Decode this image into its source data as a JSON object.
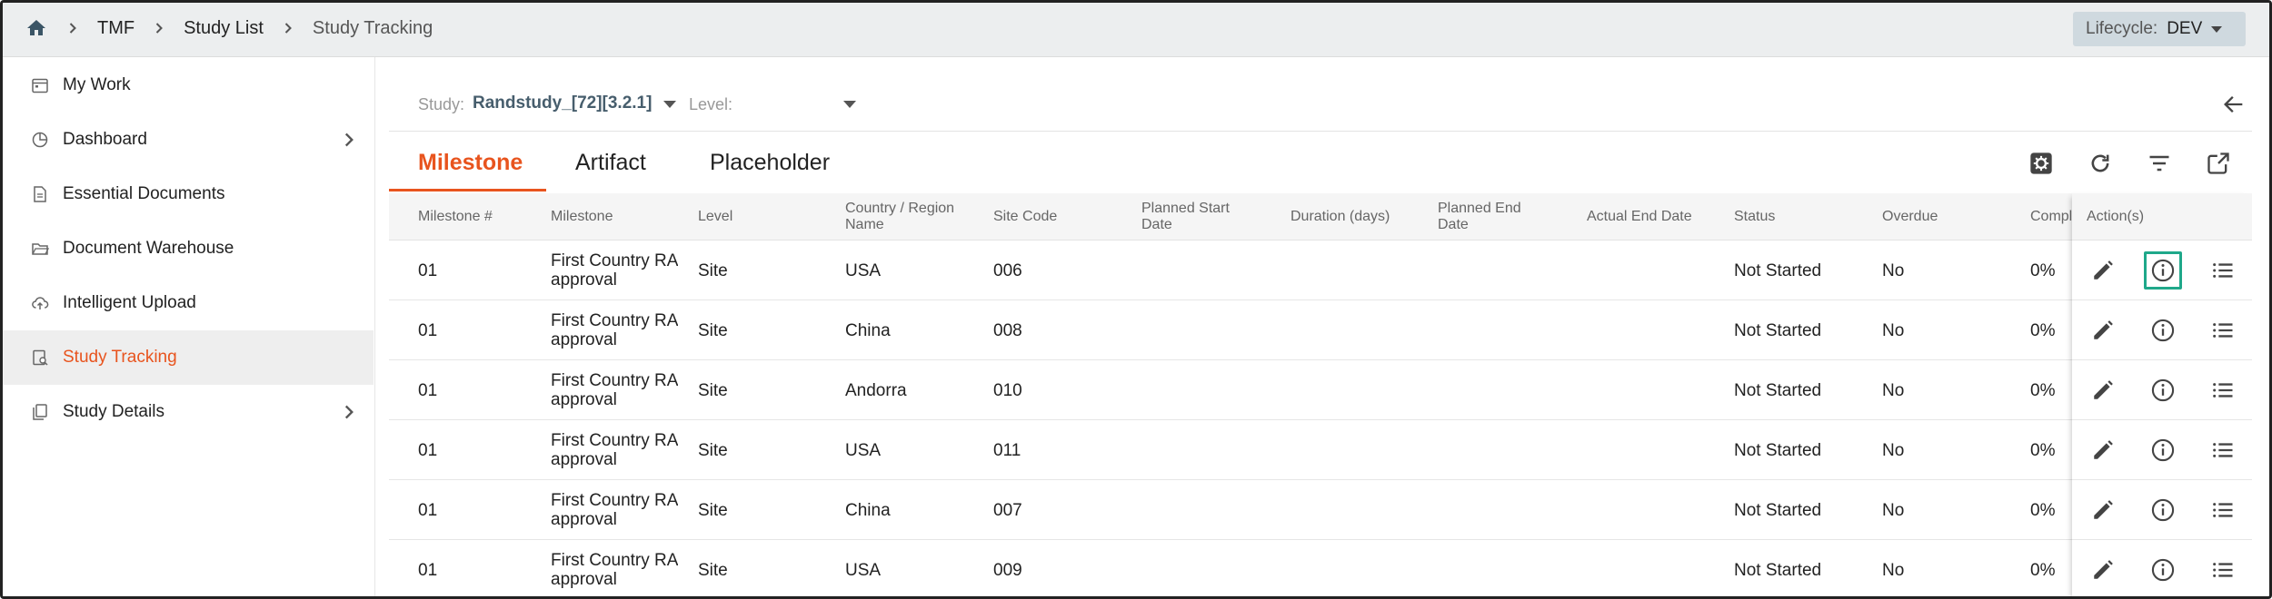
{
  "breadcrumb": {
    "items": [
      "TMF",
      "Study List",
      "Study Tracking"
    ]
  },
  "lifecycle": {
    "label": "Lifecycle:",
    "value": "DEV"
  },
  "sidebar": {
    "items": [
      {
        "label": "My Work",
        "icon": "calendar-icon",
        "has_children": false,
        "active": false
      },
      {
        "label": "Dashboard",
        "icon": "pie-chart-icon",
        "has_children": true,
        "active": false
      },
      {
        "label": "Essential Documents",
        "icon": "document-icon",
        "has_children": false,
        "active": false
      },
      {
        "label": "Document Warehouse",
        "icon": "folder-open-icon",
        "has_children": false,
        "active": false
      },
      {
        "label": "Intelligent Upload",
        "icon": "cloud-upload-icon",
        "has_children": false,
        "active": false
      },
      {
        "label": "Study Tracking",
        "icon": "tracking-icon",
        "has_children": false,
        "active": true
      },
      {
        "label": "Study Details",
        "icon": "copy-document-icon",
        "has_children": true,
        "active": false
      }
    ]
  },
  "filters": {
    "study_label": "Study:",
    "study_value": "Randstudy_[72][3.2.1]",
    "level_label": "Level:",
    "level_value": ""
  },
  "tabs": [
    {
      "label": "Milestone",
      "active": true
    },
    {
      "label": "Artifact",
      "active": false
    },
    {
      "label": "Placeholder",
      "active": false
    }
  ],
  "toolbar_icons": [
    "settings-icon",
    "refresh-icon",
    "filter-icon",
    "open-external-icon"
  ],
  "table": {
    "columns": [
      "Milestone #",
      "Milestone",
      "Level",
      "Country / Region\nName",
      "Site Code",
      "Planned Start\nDate",
      "Duration (days)",
      "Planned End\nDate",
      "Actual End Date",
      "Status",
      "Overdue",
      "Compl"
    ],
    "actions_header": "Action(s)",
    "rows": [
      {
        "milestone_num": "01",
        "milestone": "First Country RA approval",
        "level": "Site",
        "country": "USA",
        "site_code": "006",
        "planned_start": "",
        "duration": "",
        "planned_end": "",
        "actual_end": "",
        "status": "Not Started",
        "overdue": "No",
        "completion": "0%"
      },
      {
        "milestone_num": "01",
        "milestone": "First Country RA approval",
        "level": "Site",
        "country": "China",
        "site_code": "008",
        "planned_start": "",
        "duration": "",
        "planned_end": "",
        "actual_end": "",
        "status": "Not Started",
        "overdue": "No",
        "completion": "0%"
      },
      {
        "milestone_num": "01",
        "milestone": "First Country RA approval",
        "level": "Site",
        "country": "Andorra",
        "site_code": "010",
        "planned_start": "",
        "duration": "",
        "planned_end": "",
        "actual_end": "",
        "status": "Not Started",
        "overdue": "No",
        "completion": "0%"
      },
      {
        "milestone_num": "01",
        "milestone": "First Country RA approval",
        "level": "Site",
        "country": "USA",
        "site_code": "011",
        "planned_start": "",
        "duration": "",
        "planned_end": "",
        "actual_end": "",
        "status": "Not Started",
        "overdue": "No",
        "completion": "0%"
      },
      {
        "milestone_num": "01",
        "milestone": "First Country RA approval",
        "level": "Site",
        "country": "China",
        "site_code": "007",
        "planned_start": "",
        "duration": "",
        "planned_end": "",
        "actual_end": "",
        "status": "Not Started",
        "overdue": "No",
        "completion": "0%"
      },
      {
        "milestone_num": "01",
        "milestone": "First Country RA approval",
        "level": "Site",
        "country": "USA",
        "site_code": "009",
        "planned_start": "",
        "duration": "",
        "planned_end": "",
        "actual_end": "",
        "status": "Not Started",
        "overdue": "No",
        "completion": "0%"
      }
    ],
    "row_action_icons": [
      "edit-icon",
      "info-icon",
      "list-icon"
    ],
    "focused_action": {
      "row": 0,
      "icon": "info-icon"
    }
  },
  "colors": {
    "accent": "#e8541e",
    "focus": "#1fa88a",
    "study_value": "#475e6d",
    "lifecycle_bg": "#cfd9df"
  }
}
